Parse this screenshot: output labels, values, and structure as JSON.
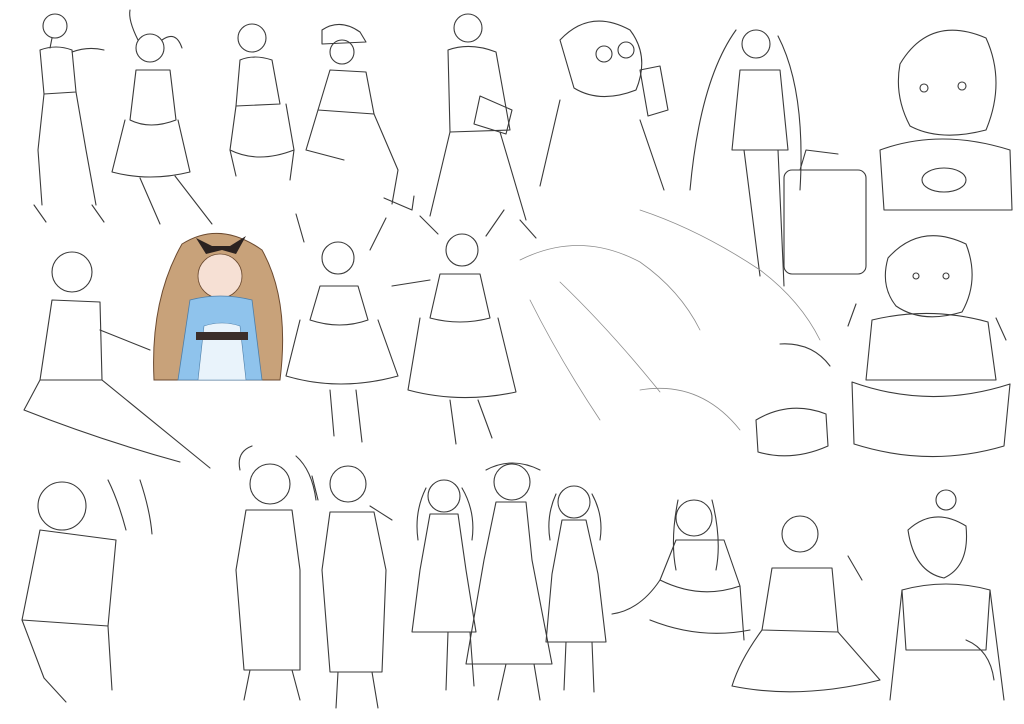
{
  "image": {
    "kind": "sketch-sheet",
    "subject": "anime-girl-pose-sketches",
    "line_color": "#3a3a3a",
    "paper_color": "#ffffff",
    "colored_figure": {
      "hair_color": "#c8a27a",
      "bow_color": "#2b2220",
      "dress_color": "#8fc3ec",
      "apron_color": "#e9f3fb",
      "skin_color": "#f6e0d4"
    }
  }
}
